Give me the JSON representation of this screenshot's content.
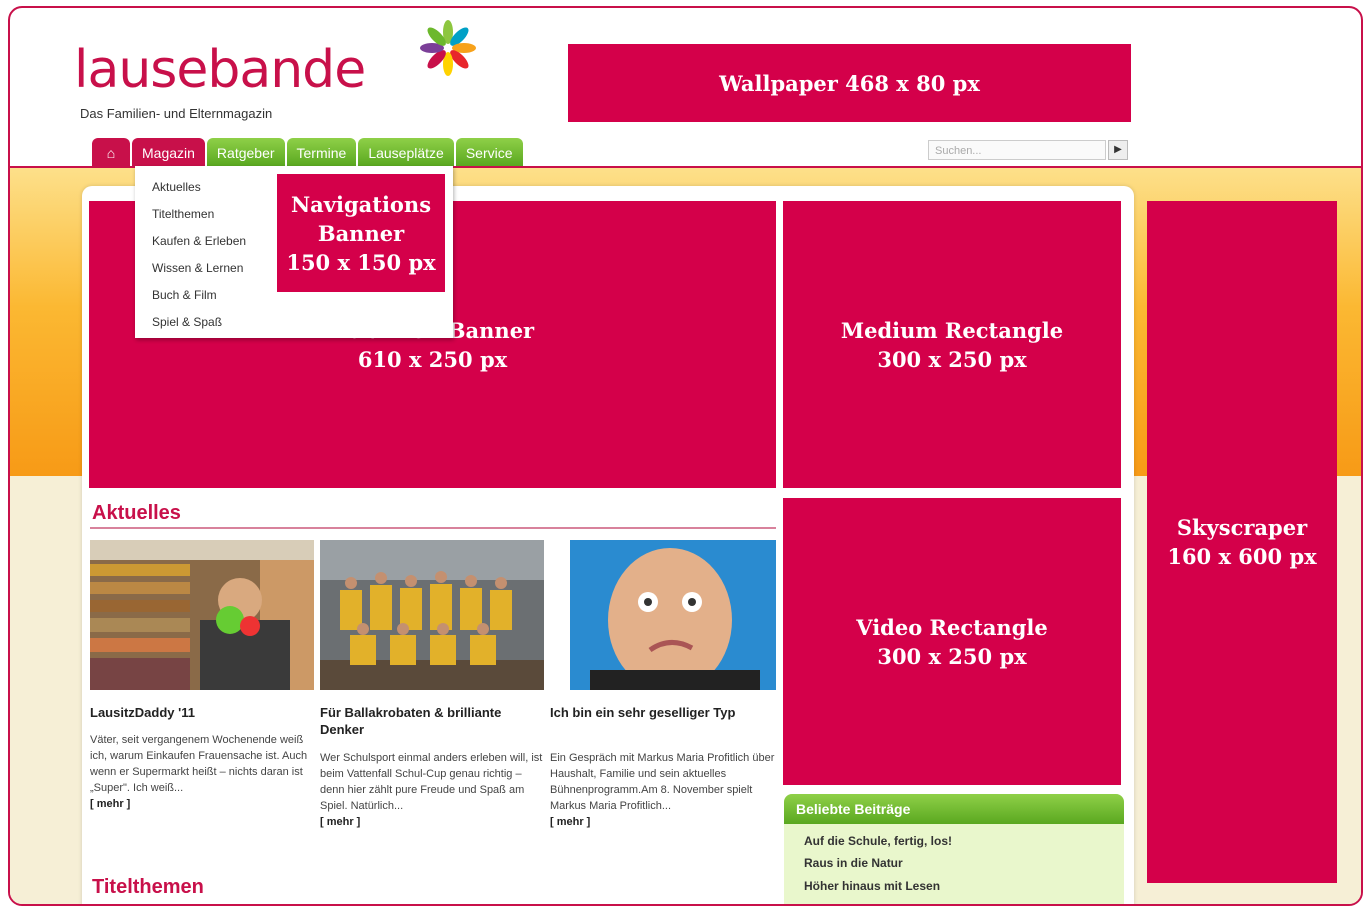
{
  "brand": {
    "logo_text": "lausebande",
    "tagline": "Das Familien- und Elternmagazin",
    "accent_color": "#d4004a",
    "nav_green": "#6cb82c",
    "flower_icon": "flower-logo-icon"
  },
  "nav": {
    "home_icon": "⌂",
    "items": [
      "Magazin",
      "Ratgeber",
      "Termine",
      "Lauseplätze",
      "Service"
    ],
    "active": "Magazin"
  },
  "search": {
    "placeholder": "Suchen...",
    "button_icon": "▶"
  },
  "dropdown": {
    "items": [
      "Aktuelles",
      "Titelthemen",
      "Kaufen & Erleben",
      "Wissen & Lernen",
      "Buch & Film",
      "Spiel & Spaß"
    ]
  },
  "ads": {
    "wallpaper": {
      "name": "Wallpaper 468 x 80 px"
    },
    "navigation": {
      "line1": "Navigations",
      "line2": "Banner",
      "line3": "150 x 150 px"
    },
    "rubriken": {
      "line1": "Rubriken Banner",
      "line2": "610 x 250 px"
    },
    "medium": {
      "line1": "Medium Rectangle",
      "line2": "300 x 250 px"
    },
    "video": {
      "line1": "Video Rectangle",
      "line2": "300 x 250 px"
    },
    "skyscraper": {
      "line1": "Skyscraper",
      "line2": "160 x 600 px"
    }
  },
  "aktuelles": {
    "title": "Aktuelles",
    "articles": [
      {
        "title": "LausitzDaddy '11",
        "text": "Väter, seit vergangenem Wochenende weiß ich, warum Einkaufen Frauensache ist. Auch wenn er Supermarkt heißt – nichts daran ist „Super\". Ich weiß...",
        "more": "[ mehr ]"
      },
      {
        "title": "Für Ballakrobaten & brilliante Denker",
        "text": "Wer Schulsport einmal anders erleben will, ist beim Vattenfall Schul-Cup genau richtig – denn hier zählt pure Freude und Spaß am Spiel. Natürlich...",
        "more": "[ mehr ]"
      },
      {
        "title": "Ich bin ein sehr geselliger Typ",
        "text": "Ein Gespräch mit Markus Maria Profitlich über Haushalt, Familie und sein aktuelles Bühnenprogramm.Am 8. November spielt Markus Maria Profitlich...",
        "more": "[ mehr ]"
      }
    ]
  },
  "titelthemen": {
    "title": "Titelthemen"
  },
  "popular": {
    "title": "Beliebte Beiträge",
    "items": [
      "Auf die Schule, fertig, los!",
      "Raus in die Natur",
      "Höher hinaus mit Lesen"
    ]
  }
}
